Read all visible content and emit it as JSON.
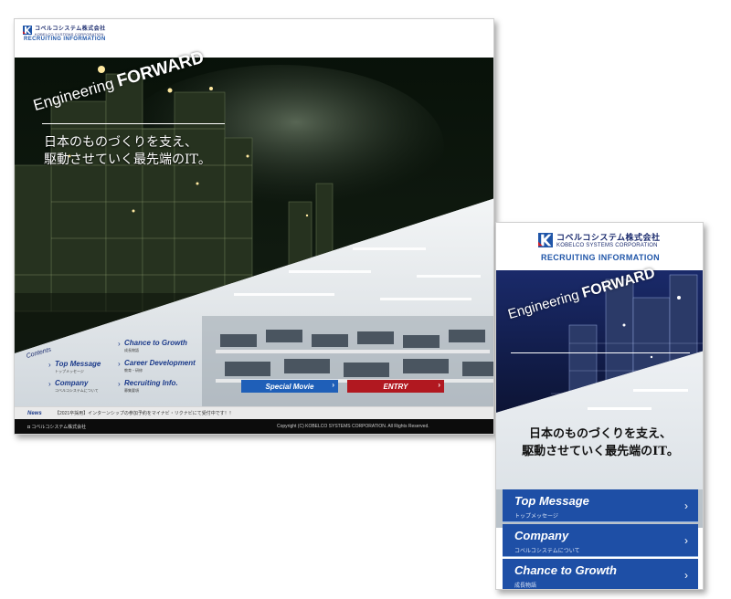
{
  "desktop": {
    "logo": {
      "jp": "コベルコシステム株式会社",
      "en": "KOBELCO SYSTEMS CORPORATION"
    },
    "recruiting_label": "RECRUITING INFORMATION",
    "hero": {
      "engineering": "Engineering",
      "forward": "FORWARD",
      "tagline_line1": "日本のものづくりを支え、",
      "tagline_line2": "駆動させていく最先端のIT。"
    },
    "contents_label": "Contents",
    "nav": [
      {
        "en": "Top Message",
        "jp": "トップメッセージ"
      },
      {
        "en": "Company",
        "jp": "コベルコシステムについて"
      },
      {
        "en": "Chance to Growth",
        "jp": "成長物語"
      },
      {
        "en": "Career Development",
        "jp": "教育・研修"
      },
      {
        "en": "Recruiting Info.",
        "jp": "募集要項"
      }
    ],
    "special_movie": "Special Movie",
    "entry": "ENTRY",
    "news_label": "News",
    "news_text": "【2021卒採用】インターンシップの参加予約をマイナビ・リクナビにて受付中です！！",
    "footer_brand": "コベルコシステム株式会社",
    "copyright": "Copyright (C) KOBELCO SYSTEMS CORPORATION. All Rights Reserved."
  },
  "mobile": {
    "logo": {
      "jp": "コベルコシステム株式会社",
      "en": "KOBELCO SYSTEMS CORPORATION"
    },
    "recruiting_label": "RECRUITING INFORMATION",
    "hero": {
      "engineering": "Engineering",
      "forward": "FORWARD",
      "tagline_line1": "日本のものづくりを支え、",
      "tagline_line2": "駆動させていく最先端のIT。"
    },
    "nav": [
      {
        "en": "Top Message",
        "jp": "トップメッセージ"
      },
      {
        "en": "Company",
        "jp": "コベルコシステムについて"
      },
      {
        "en": "Chance to Growth",
        "jp": "成長物語"
      }
    ]
  },
  "icons": {
    "chevron": "›",
    "arrow": "›",
    "footer_mark": "◘"
  },
  "colors": {
    "brand_navy": "#1b2b6e",
    "accent_blue": "#1e4fa6",
    "entry_red": "#b11820",
    "movie_blue": "#1f5fb8"
  }
}
